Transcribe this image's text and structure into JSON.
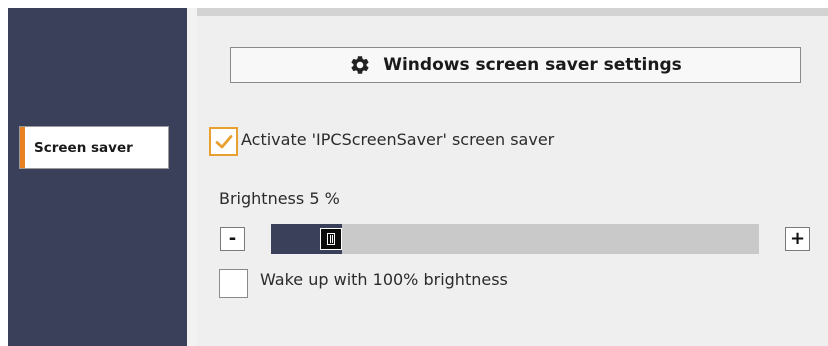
{
  "sidebar": {
    "items": [
      {
        "label": "Screen saver",
        "selected": true
      }
    ],
    "accent_color": "#e8821e",
    "background_color": "#3a3f5a"
  },
  "settings_button": {
    "label": "Windows screen saver settings",
    "icon": "gear-icon"
  },
  "activate": {
    "label": "Activate 'IPCScreenSaver' screen saver",
    "checked": true,
    "check_color": "#e8a030"
  },
  "brightness": {
    "label": "Brightness 5 %",
    "value_percent": 5,
    "minus_label": "-",
    "plus_label": "+"
  },
  "wake": {
    "label": "Wake up with 100% brightness",
    "checked": false
  }
}
